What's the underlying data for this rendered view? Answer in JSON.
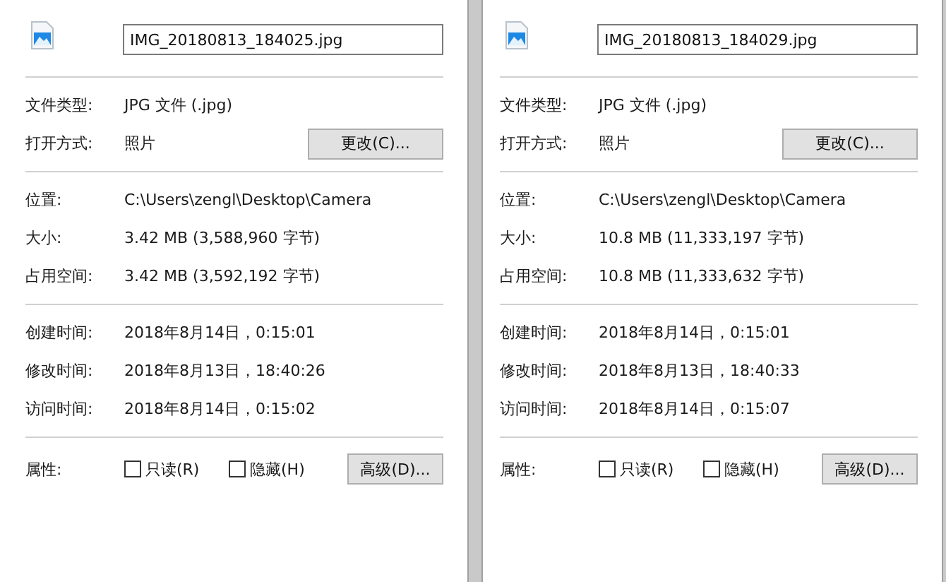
{
  "panels": [
    {
      "filename": "IMG_20180813_184025.jpg",
      "sections": [
        [
          {
            "label": "文件类型:",
            "value": "JPG 文件 (.jpg)"
          },
          {
            "label": "打开方式:",
            "value": "照片",
            "button": "更改(C)..."
          }
        ],
        [
          {
            "label": "位置:",
            "value": "C:\\Users\\zengl\\Desktop\\Camera"
          },
          {
            "label": "大小:",
            "value": "3.42 MB (3,588,960 字节)"
          },
          {
            "label": "占用空间:",
            "value": "3.42 MB (3,592,192 字节)"
          }
        ],
        [
          {
            "label": "创建时间:",
            "value": "2018年8月14日，0:15:01"
          },
          {
            "label": "修改时间:",
            "value": "2018年8月13日，18:40:26"
          },
          {
            "label": "访问时间:",
            "value": "2018年8月14日，0:15:02"
          }
        ]
      ],
      "attributes": {
        "label": "属性:",
        "checkboxes": [
          {
            "label": "只读(R)",
            "checked": false
          },
          {
            "label": "隐藏(H)",
            "checked": false
          }
        ],
        "button": "高级(D)..."
      }
    },
    {
      "filename": "IMG_20180813_184029.jpg",
      "sections": [
        [
          {
            "label": "文件类型:",
            "value": "JPG 文件 (.jpg)"
          },
          {
            "label": "打开方式:",
            "value": "照片",
            "button": "更改(C)..."
          }
        ],
        [
          {
            "label": "位置:",
            "value": "C:\\Users\\zengl\\Desktop\\Camera"
          },
          {
            "label": "大小:",
            "value": "10.8 MB (11,333,197 字节)"
          },
          {
            "label": "占用空间:",
            "value": "10.8 MB (11,333,632 字节)"
          }
        ],
        [
          {
            "label": "创建时间:",
            "value": "2018年8月14日，0:15:01"
          },
          {
            "label": "修改时间:",
            "value": "2018年8月13日，18:40:33"
          },
          {
            "label": "访问时间:",
            "value": "2018年8月14日，0:15:07"
          }
        ]
      ],
      "attributes": {
        "label": "属性:",
        "checkboxes": [
          {
            "label": "只读(R)",
            "checked": false
          },
          {
            "label": "隐藏(H)",
            "checked": false
          }
        ],
        "button": "高级(D)..."
      }
    }
  ]
}
